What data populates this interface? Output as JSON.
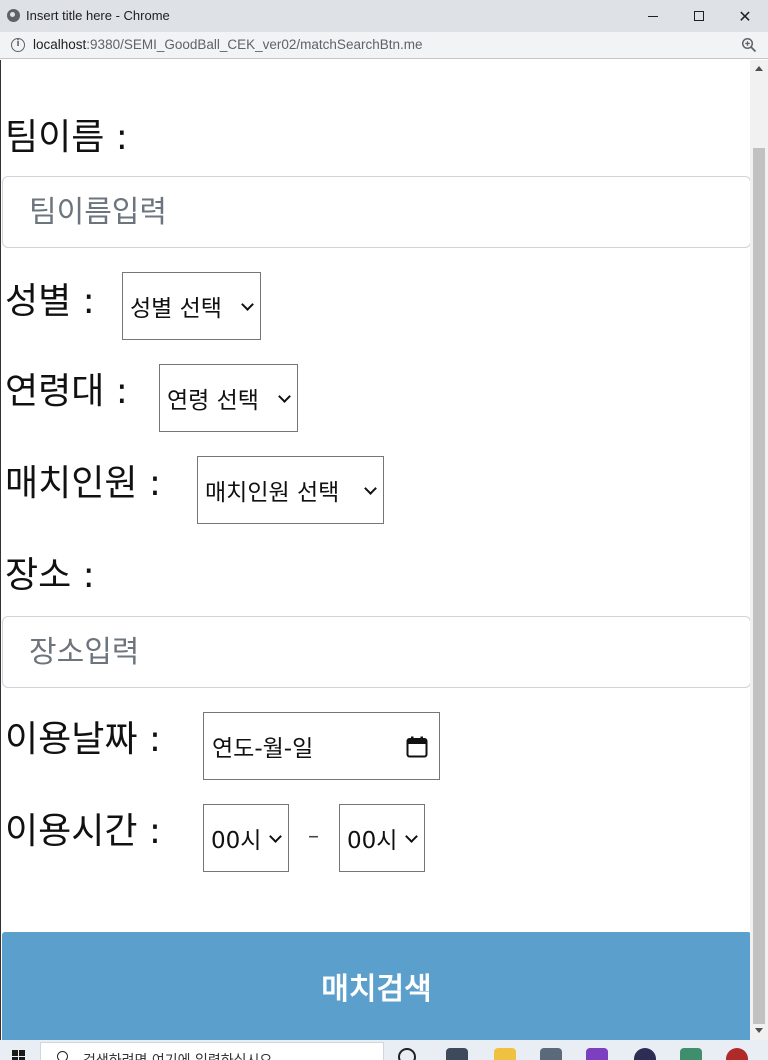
{
  "browser": {
    "tab_title": "Insert title here - Chrome",
    "url_host": "localhost",
    "url_path": ":9380/SEMI_GoodBall_CEK_ver02/matchSearchBtn.me"
  },
  "form": {
    "team_name": {
      "label": "팀이름 :",
      "placeholder": "팀이름입력",
      "value": ""
    },
    "gender": {
      "label": "성별 :",
      "selected": "성별 선택"
    },
    "age_group": {
      "label": "연령대 :",
      "selected": "연령 선택"
    },
    "match_size": {
      "label": "매치인원 :",
      "selected": "매치인원 선택"
    },
    "place": {
      "label": "장소 :",
      "placeholder": "장소입력",
      "value": ""
    },
    "use_date": {
      "label": "이용날짜 :",
      "value": "연도-월-일"
    },
    "use_time": {
      "label": "이용시간 :",
      "start": "00시",
      "separator": "–",
      "end": "00시"
    },
    "submit_label": "매치검색"
  },
  "taskbar": {
    "search_placeholder": "검색하려면 여기에 입력하십시오."
  },
  "colors": {
    "submit_bg": "#5b9fcd",
    "titlebar_bg": "#dee1e6",
    "addressbar_bg": "#f1f3f4"
  }
}
